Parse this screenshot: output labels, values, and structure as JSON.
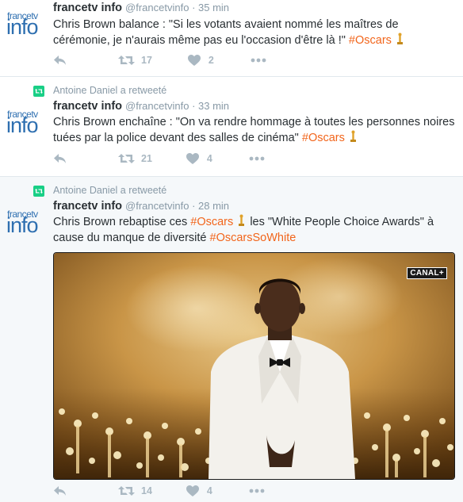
{
  "tweets": [
    {
      "retweeted_by": "",
      "avatar": {
        "top_text": "francetv",
        "big_text": "info"
      },
      "name": "francetv info",
      "handle": "@francetvinfo",
      "time": "35 min",
      "text_a": "Chris Brown balance : \"Si les votants avaient nommé les maîtres de cérémonie, je n'aurais même pas eu l'occasion d'être là !\" ",
      "hashtag_1": "#Oscars",
      "retweets": "17",
      "likes": "2"
    },
    {
      "retweeted_by": "Antoine Daniel a retweeté",
      "avatar": {
        "top_text": "francetv",
        "big_text": "info"
      },
      "name": "francetv info",
      "handle": "@francetvinfo",
      "time": "33 min",
      "text_a": "Chris Brown enchaîne : \"On va rendre hommage à toutes les personnes noires tuées par la police devant des salles de cinéma\" ",
      "hashtag_1": "#Oscars",
      "retweets": "21",
      "likes": "4"
    },
    {
      "retweeted_by": "Antoine Daniel a retweeté",
      "avatar": {
        "top_text": "francetv",
        "big_text": "info"
      },
      "name": "francetv info",
      "handle": "@francetvinfo",
      "time": "28 min",
      "text_a": "Chris Brown rebaptise ces ",
      "hashtag_1": "#Oscars",
      "text_b": " les \"White People Choice Awards\" à cause du manque de diversité ",
      "hashtag_2": "#OscarsSoWhite",
      "media_logo": "CANAL+",
      "retweets": "14",
      "likes": "4"
    }
  ],
  "colors": {
    "hashtag": "#f2651b",
    "meta": "#8899a6",
    "icon": "#aab8c2",
    "retweet_badge": "#19cf86",
    "avatar_blue": "#2e6fb0"
  }
}
